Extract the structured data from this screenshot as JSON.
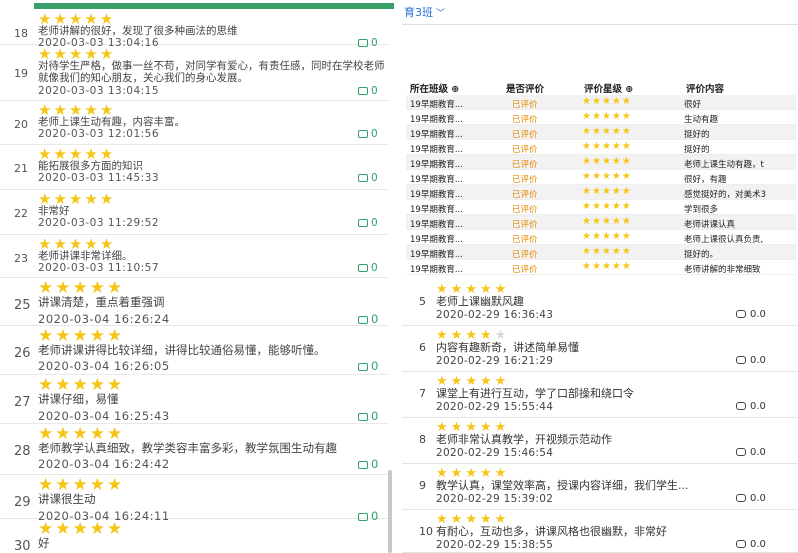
{
  "left": {
    "rows": [
      {
        "num": "18",
        "stars": 5,
        "text": "老师讲解的很好，发现了很多种画法的思维",
        "date": "2020-03-03 13:04:16",
        "comments": "0"
      },
      {
        "num": "19",
        "stars": 5,
        "text": "对待学生严格，做事一丝不苟，对同学有爱心，有责任感，同时在学校老师就像我们的知心朋友，关心我们的身心发展。",
        "date": "2020-03-03 13:04:15",
        "comments": "0"
      },
      {
        "num": "20",
        "stars": 5,
        "text": "老师上课生动有趣，内容丰富。",
        "date": "2020-03-03 12:01:56",
        "comments": "0"
      },
      {
        "num": "21",
        "stars": 5,
        "text": "能拓展很多方面的知识",
        "date": "2020-03-03 11:45:33",
        "comments": "0"
      },
      {
        "num": "22",
        "stars": 5,
        "text": "非常好",
        "date": "2020-03-03 11:29:52",
        "comments": "0"
      },
      {
        "num": "23",
        "stars": 5,
        "text": "老师讲课非常详细。",
        "date": "2020-03-03 11:10:57",
        "comments": "0"
      },
      {
        "num": "25",
        "stars": 5,
        "text": "讲课清楚，重点着重强调",
        "date": "2020-03-04 16:26:24",
        "comments": "0"
      },
      {
        "num": "26",
        "stars": 5,
        "text": "老师讲课讲得比较详细，讲得比较通俗易懂，能够听懂。",
        "date": "2020-03-04 16:26:05",
        "comments": "0"
      },
      {
        "num": "27",
        "stars": 5,
        "text": "讲课仔细，易懂",
        "date": "2020-03-04 16:25:43",
        "comments": "0"
      },
      {
        "num": "28",
        "stars": 5,
        "text": "老师教学认真细致，教学类容丰富多彩，教学氛围生动有趣",
        "date": "2020-03-04 16:24:42",
        "comments": "0"
      },
      {
        "num": "29",
        "stars": 5,
        "text": "讲课很生动",
        "date": "2020-03-04 16:24:11",
        "comments": "0"
      },
      {
        "num": "30",
        "stars": 5,
        "text": "好",
        "date": "",
        "comments": ""
      }
    ]
  },
  "right": {
    "class_selector": "育3班",
    "table": {
      "headers": [
        "所在班级 ⊕",
        "是否评价",
        "评价星级 ⊕",
        "评价内容"
      ],
      "rows": [
        {
          "cls": "19早期教育...",
          "status": "已评价",
          "stars": 5,
          "content": "很好"
        },
        {
          "cls": "19早期教育...",
          "status": "已评价",
          "stars": 5,
          "content": "生动有趣"
        },
        {
          "cls": "19早期教育...",
          "status": "已评价",
          "stars": 5,
          "content": "挺好的"
        },
        {
          "cls": "19早期教育...",
          "status": "已评价",
          "stars": 5,
          "content": "挺好的"
        },
        {
          "cls": "19早期教育...",
          "status": "已评价",
          "stars": 5,
          "content": "老师上课生动有趣，t"
        },
        {
          "cls": "19早期教育...",
          "status": "已评价",
          "stars": 5,
          "content": "很好，有趣"
        },
        {
          "cls": "19早期教育...",
          "status": "已评价",
          "stars": 5,
          "content": "感觉挺好的，对美术3"
        },
        {
          "cls": "19早期教育...",
          "status": "已评价",
          "stars": 5,
          "content": "学到很多"
        },
        {
          "cls": "19早期教育...",
          "status": "已评价",
          "stars": 5,
          "content": "老师讲课认真"
        },
        {
          "cls": "19早期教育...",
          "status": "已评价",
          "stars": 5,
          "content": "老师上课很认真负责,"
        },
        {
          "cls": "19早期教育...",
          "status": "已评价",
          "stars": 5,
          "content": "挺好的。"
        },
        {
          "cls": "19早期教育...",
          "status": "已评价",
          "stars": 5,
          "content": "老师讲解的非常细致"
        }
      ]
    },
    "rows": [
      {
        "num": "5",
        "stars": 5,
        "text": "老师上课幽默风趣",
        "date": "2020-02-29 16:36:43",
        "comments": "0.0"
      },
      {
        "num": "6",
        "stars": 4,
        "text": "内容有趣新奇，讲述简单易懂",
        "date": "2020-02-29 16:21:29",
        "comments": "0.0"
      },
      {
        "num": "7",
        "stars": 5,
        "text": "课堂上有进行互动，学了口部操和绕口令",
        "date": "2020-02-29 15:55:44",
        "comments": "0.0"
      },
      {
        "num": "8",
        "stars": 5,
        "text": "老师非常认真教学，开视频示范动作",
        "date": "2020-02-29 15:46:54",
        "comments": "0.0"
      },
      {
        "num": "9",
        "stars": 5,
        "text": "教学认真，课堂效率高，授课内容详细，我们学生...",
        "date": "2020-02-29 15:39:02",
        "comments": "0.0"
      },
      {
        "num": "10",
        "stars": 5,
        "text": "有耐心，互动也多，讲课风格也很幽默，非常好",
        "date": "2020-02-29 15:38:55",
        "comments": "0.0"
      }
    ]
  }
}
